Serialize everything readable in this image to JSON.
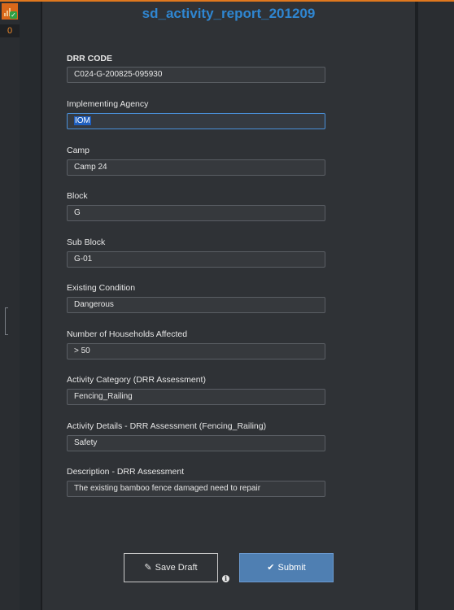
{
  "page_title": "sd_activity_report_201209",
  "rail": {
    "app_icon": "bar-chart-check-icon",
    "count": "0"
  },
  "form": {
    "fields": [
      {
        "label": "DRR CODE",
        "value": "C024-G-200825-095930"
      },
      {
        "label": "Implementing Agency",
        "value": "IOM"
      },
      {
        "label": "Camp",
        "value": "Camp 24"
      },
      {
        "label": "Block",
        "value": "G"
      },
      {
        "label": "Sub Block",
        "value": "G-01"
      },
      {
        "label": "Existing Condition",
        "value": "Dangerous"
      },
      {
        "label": "Number of Households Affected",
        "value": "> 50"
      },
      {
        "label": "Activity Category (DRR Assessment)",
        "value": "Fencing_Railing"
      },
      {
        "label": "Activity Details - DRR Assessment (Fencing_Railing)",
        "value": "Safety"
      },
      {
        "label": "Description - DRR Assessment",
        "value": "The existing bamboo fence damaged need to repair"
      }
    ]
  },
  "actions": {
    "save_draft_label": "Save Draft",
    "save_draft_icon": "pencil-icon",
    "submit_label": "Submit",
    "submit_icon": "check-icon",
    "info_icon": "info-icon"
  },
  "colors": {
    "title": "#2f86d1",
    "submit_bg": "#4f7fb2",
    "accent_top": "#e0781e",
    "counter_text": "#f08a2a"
  }
}
